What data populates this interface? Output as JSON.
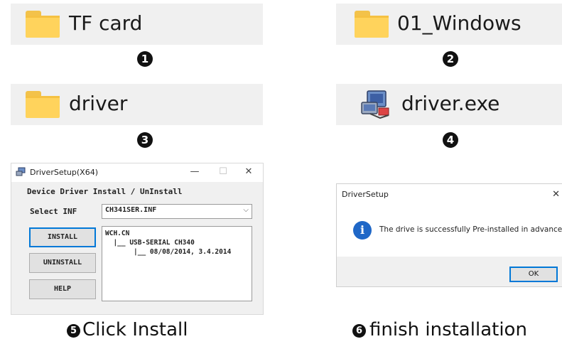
{
  "steps": [
    {
      "number": "1",
      "label": "TF card",
      "icon": "folder-icon"
    },
    {
      "number": "2",
      "label": "01_Windows",
      "icon": "folder-icon"
    },
    {
      "number": "3",
      "label": "driver",
      "icon": "folder-icon"
    },
    {
      "number": "4",
      "label": "driver.exe",
      "icon": "installer-exe-icon"
    }
  ],
  "setup_window": {
    "title": "DriverSetup(X64)",
    "controls": {
      "minimize": "—",
      "maximize": "☐",
      "close": "✕"
    },
    "group_title": "Device Driver Install / UnInstall",
    "select_label": "Select INF",
    "select_value": "CH341SER.INF",
    "buttons": {
      "install": "INSTALL",
      "uninstall": "UNINSTALL",
      "help": "HELP"
    },
    "info_lines": [
      "WCH.CN",
      "  |__ USB-SERIAL CH340",
      "       |__ 08/08/2014, 3.4.2014"
    ]
  },
  "captions": {
    "step5_number": "5",
    "step5_text": "Click Install",
    "step6_number": "6",
    "step6_text": "finish installation"
  },
  "dialog": {
    "title": "DriverSetup",
    "close": "✕",
    "message": "The drive is successfully Pre-installed in advance!",
    "ok_label": "OK",
    "icon": "info-icon"
  },
  "colors": {
    "folder": "#ffd35c",
    "tile_bg": "#f0f0f0",
    "info_blue": "#1f67c7",
    "focus_blue": "#0078d7"
  }
}
